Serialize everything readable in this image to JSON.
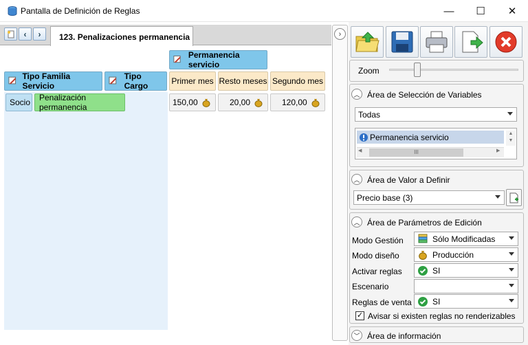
{
  "window": {
    "title": "Pantalla de Definición de Reglas",
    "minimize": "—",
    "maximize": "☐",
    "close": "✕"
  },
  "tab": {
    "label": "123. Penalizaciones permanencia"
  },
  "grid": {
    "group_header": "Permanencia servicio",
    "row_headers": [
      "Tipo Familia Servicio",
      "Tipo Cargo"
    ],
    "col_headers": [
      "Primer mes",
      "Resto meses",
      "Segundo mes"
    ],
    "row": {
      "familia": "Socio",
      "cargo": "Penalización permanencia",
      "values": [
        "150,00",
        "20,00",
        "120,00"
      ]
    }
  },
  "zoom": {
    "label": "Zoom",
    "level": 0.2
  },
  "sel_vars": {
    "title": "Área de Selección de Variables",
    "dropdown": "Todas",
    "list_item": "Permanencia servicio",
    "hscroll_grip": "III"
  },
  "valor": {
    "title": "Área de Valor a Definir",
    "dropdown": "Precio base (3)"
  },
  "params": {
    "title": "Área de Parámetros de Edición",
    "rows": [
      {
        "label": "Modo Gestión",
        "value": "Sólo Modificadas"
      },
      {
        "label": "Modo diseño",
        "value": "Producción"
      },
      {
        "label": "Activar reglas",
        "value": "SI"
      },
      {
        "label": "Escenario",
        "value": ""
      },
      {
        "label": "Reglas de venta",
        "value": "SI"
      }
    ],
    "checkbox_label": "Avisar si existen reglas no renderizables",
    "checkbox_checked": true
  },
  "info": {
    "title": "Área de información"
  },
  "colors": {
    "header_blue": "#7fc6ea",
    "header_tan": "#fbe9c8",
    "green_cell": "#8fe08a",
    "accent": "#2d7fd0"
  }
}
